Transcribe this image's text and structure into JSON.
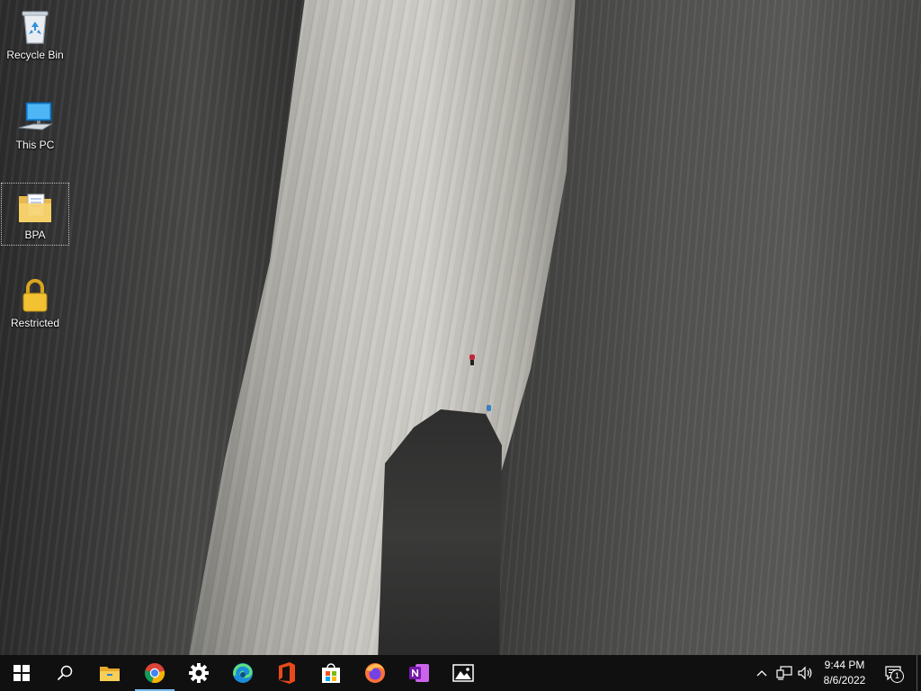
{
  "desktop": {
    "wallpaper": "granite-cliff-climber",
    "icons": [
      {
        "label": "Recycle Bin",
        "icon": "recycle-bin-icon"
      },
      {
        "label": "This PC",
        "icon": "computer-icon"
      },
      {
        "label": "BPA",
        "icon": "folder-icon"
      },
      {
        "label": "Restricted",
        "icon": "lock-icon"
      }
    ]
  },
  "taskbar": {
    "pinned": [
      {
        "name": "Start",
        "icon": "windows-icon"
      },
      {
        "name": "Search",
        "icon": "search-icon"
      },
      {
        "name": "File Explorer",
        "icon": "file-explorer-icon"
      },
      {
        "name": "Google Chrome",
        "icon": "chrome-icon",
        "active": true
      },
      {
        "name": "Settings",
        "icon": "gear-icon"
      },
      {
        "name": "Microsoft Edge",
        "icon": "edge-icon"
      },
      {
        "name": "Office",
        "icon": "office-icon"
      },
      {
        "name": "Microsoft Store",
        "icon": "store-icon"
      },
      {
        "name": "Firefox",
        "icon": "firefox-icon"
      },
      {
        "name": "OneNote",
        "icon": "onenote-icon"
      },
      {
        "name": "Photos",
        "icon": "photos-icon"
      }
    ],
    "tray": {
      "time": "9:44 PM",
      "date": "8/6/2022",
      "notification_count": "1"
    }
  },
  "colors": {
    "taskbar_bg": "#101010",
    "active_indicator": "#76b9ed"
  }
}
